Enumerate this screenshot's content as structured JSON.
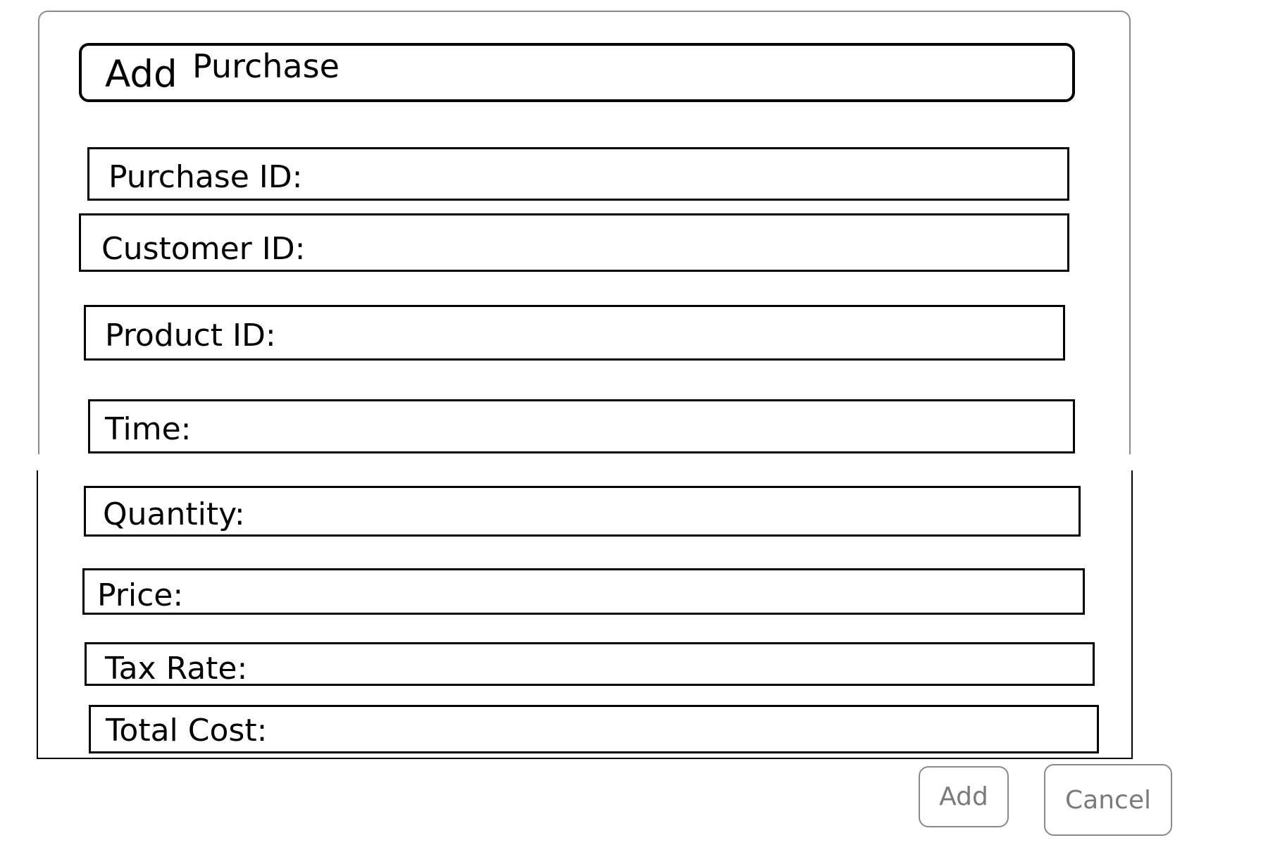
{
  "dialog": {
    "title_add": "Add",
    "title_purchase": "Purchase"
  },
  "fields": [
    {
      "label": "Purchase ID:"
    },
    {
      "label": "Customer ID:"
    },
    {
      "label": "Product ID:"
    },
    {
      "label": "Time:"
    },
    {
      "label": "Quantity:"
    },
    {
      "label": "Price:"
    },
    {
      "label": "Tax Rate:"
    },
    {
      "label": "Total Cost:"
    }
  ],
  "buttons": {
    "add_label": "Add",
    "cancel_label": "Cancel"
  },
  "colors": {
    "border": "#000000",
    "frame_top_border": "#8a8a8a",
    "button_text": "#7a7a7a"
  }
}
